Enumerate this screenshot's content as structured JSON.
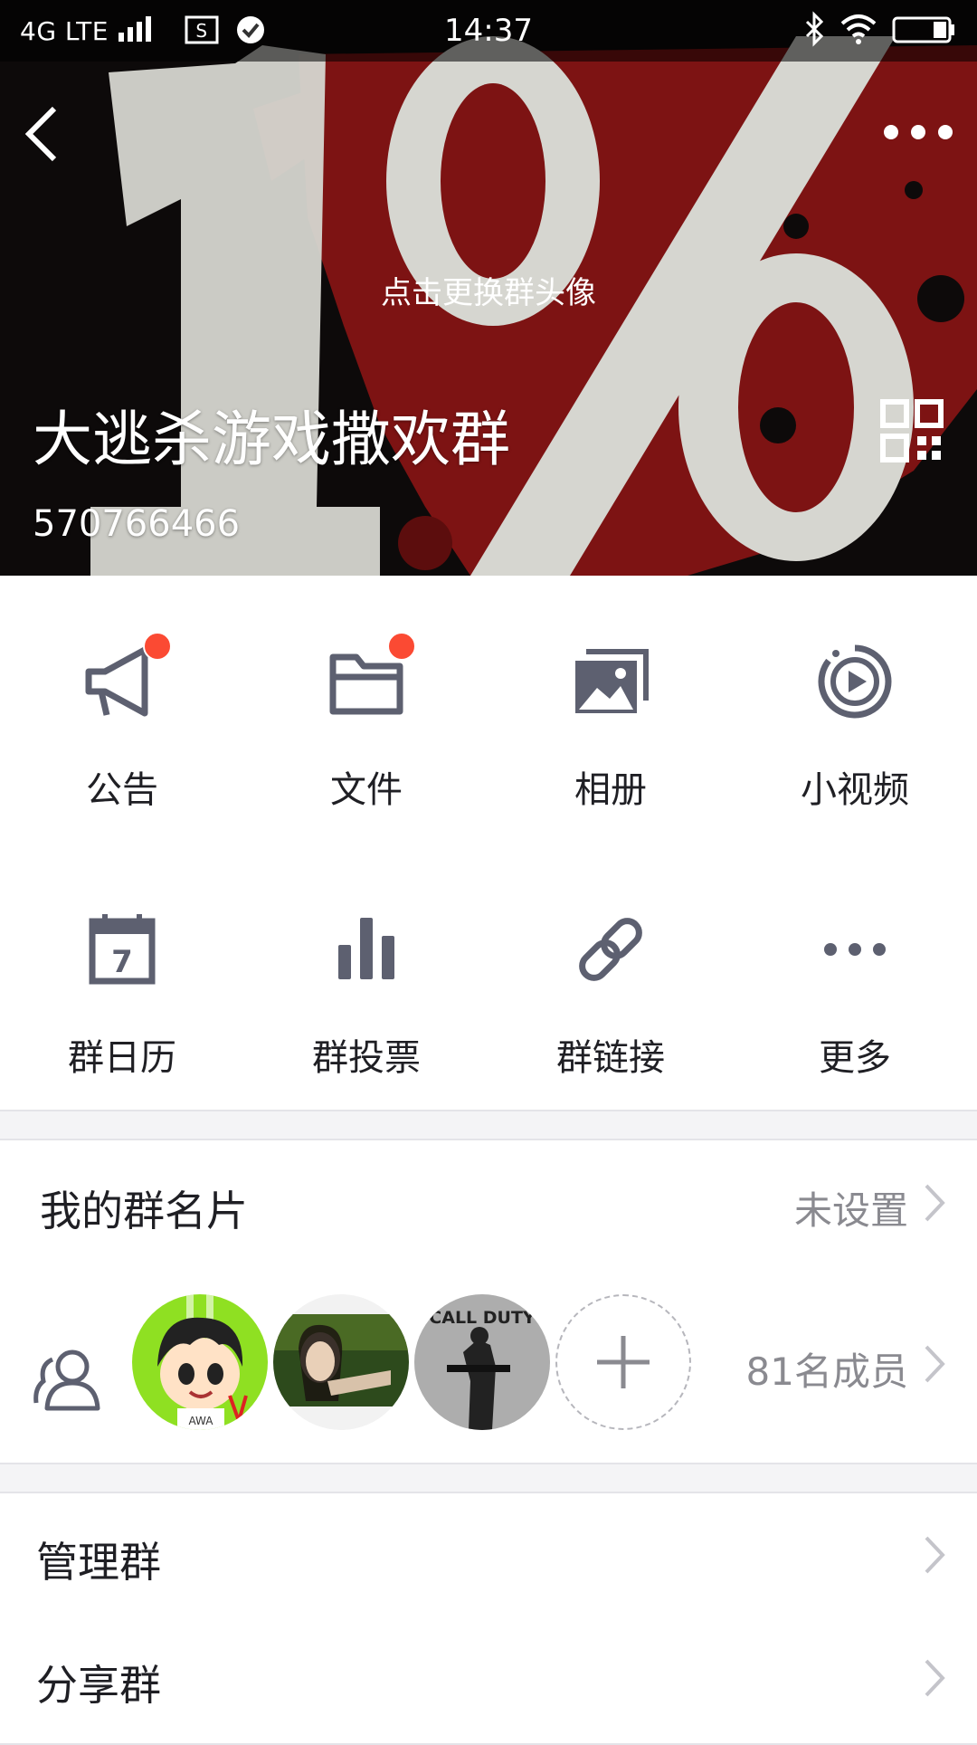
{
  "status_bar": {
    "network": "4G LTE",
    "time": "14:37"
  },
  "header": {
    "change_avatar_hint": "点击更换群头像",
    "group_name": "大逃杀游戏撒欢群",
    "group_id": "570766466",
    "cover_text": "1%"
  },
  "features": [
    {
      "label": "公告",
      "icon": "megaphone-icon",
      "badge": true
    },
    {
      "label": "文件",
      "icon": "folder-icon",
      "badge": true
    },
    {
      "label": "相册",
      "icon": "photo-album-icon",
      "badge": false
    },
    {
      "label": "小视频",
      "icon": "video-icon",
      "badge": false
    },
    {
      "label": "群日历",
      "icon": "calendar-icon",
      "calendar_day": "7",
      "badge": false
    },
    {
      "label": "群投票",
      "icon": "bar-chart-icon",
      "badge": false
    },
    {
      "label": "群链接",
      "icon": "link-icon",
      "badge": false
    },
    {
      "label": "更多",
      "icon": "ellipsis-icon",
      "badge": false
    }
  ],
  "my_card": {
    "title": "我的群名片",
    "value": "未设置"
  },
  "members": {
    "count_label": "81名成员",
    "avatar_texts": [
      "AWA",
      "CALL DUTY"
    ]
  },
  "actions": [
    {
      "label": "管理群"
    },
    {
      "label": "分享群"
    }
  ],
  "colors": {
    "badge": "#fb4a33",
    "icon": "#5d6070",
    "hero_red": "#7d1313",
    "hero_digit": "#d6d6d0"
  }
}
